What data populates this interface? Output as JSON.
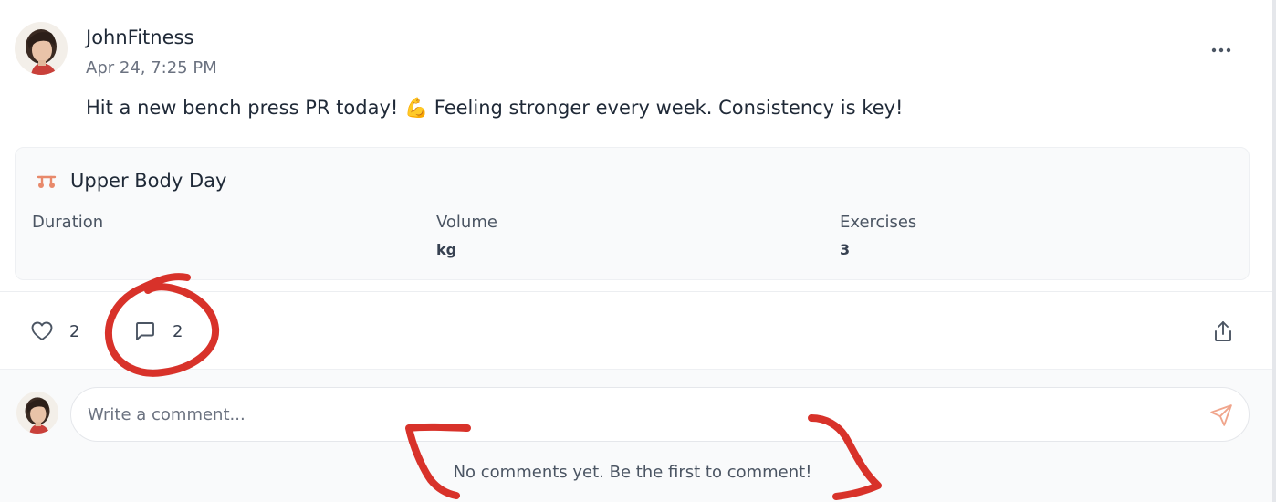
{
  "post": {
    "author": "JohnFitness",
    "timestamp": "Apr 24, 7:25 PM",
    "text": "Hit a new bench press PR today! 💪 Feeling stronger every week. Consistency is key!",
    "menu_icon": "more-horizontal-icon"
  },
  "workout": {
    "icon": "dumbbell-icon",
    "title": "Upper Body Day",
    "accent_color": "#e8896b",
    "stats": [
      {
        "label": "Duration",
        "value": ""
      },
      {
        "label": "Volume",
        "value": "kg"
      },
      {
        "label": "Exercises",
        "value": "3"
      }
    ]
  },
  "actions": {
    "like_icon": "heart-icon",
    "like_count": "2",
    "comment_icon": "comment-icon",
    "comment_count": "2",
    "share_icon": "share-icon"
  },
  "comments": {
    "input_placeholder": "Write a comment...",
    "input_value": "",
    "send_icon": "send-icon",
    "empty_message": "No comments yet. Be the first to comment!",
    "send_color": "#f0a58c"
  },
  "annotation_color": "#d8322a"
}
